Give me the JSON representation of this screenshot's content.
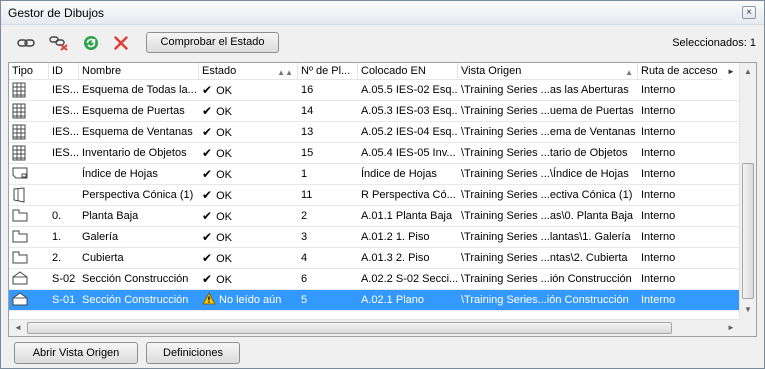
{
  "window": {
    "title": "Gestor de Dibujos",
    "close_glyph": "×"
  },
  "toolbar": {
    "icons": [
      "link-icon",
      "unlink-icon",
      "refresh-icon",
      "delete-icon"
    ],
    "check_status_label": "Comprobar el Estado",
    "selected_label": "Seleccionados: 1"
  },
  "table": {
    "columns": [
      {
        "label": "Tipo"
      },
      {
        "label": "ID"
      },
      {
        "label": "Nombre"
      },
      {
        "label": "Estado",
        "sort": "▲▲"
      },
      {
        "label": "Nº de Pl..."
      },
      {
        "label": "Colocado EN"
      },
      {
        "label": "Vista Origen",
        "sort": "▲"
      },
      {
        "label": "Ruta de acceso"
      }
    ],
    "header_more": "►",
    "rows": [
      {
        "type_icon": "schedule-icon",
        "id": "IES...",
        "name": "Esquema de Todas la...",
        "status": "OK",
        "status_kind": "ok",
        "sheets": "16",
        "placed_in": "A.05.5 IES-02 Esq...",
        "source_view": "\\Training Series ...as las Aberturas",
        "path": "Interno"
      },
      {
        "type_icon": "schedule-icon",
        "id": "IES...",
        "name": "Esquema de Puertas",
        "status": "OK",
        "status_kind": "ok",
        "sheets": "14",
        "placed_in": "A.05.3 IES-03 Esq...",
        "source_view": "\\Training Series ...uema de Puertas",
        "path": "Interno"
      },
      {
        "type_icon": "schedule-icon",
        "id": "IES...",
        "name": "Esquema de Ventanas",
        "status": "OK",
        "status_kind": "ok",
        "sheets": "13",
        "placed_in": "A.05.2 IES-04 Esq...",
        "source_view": "\\Training Series ...ema de Ventanas",
        "path": "Interno"
      },
      {
        "type_icon": "schedule-icon",
        "id": "IES...",
        "name": "Inventario de Objetos",
        "status": "OK",
        "status_kind": "ok",
        "sheets": "15",
        "placed_in": "A.05.4 IES-05 Inv...",
        "source_view": "\\Training Series ...tario de Objetos",
        "path": "Interno"
      },
      {
        "type_icon": "sheet-index-icon",
        "id": "",
        "name": "Índice de Hojas",
        "status": "OK",
        "status_kind": "ok",
        "sheets": "1",
        "placed_in": "Índice de Hojas",
        "source_view": "\\Training Series ...\\Índice de Hojas",
        "path": "Interno"
      },
      {
        "type_icon": "perspective-icon",
        "id": "",
        "name": "Perspectiva Cónica (1)",
        "status": "OK",
        "status_kind": "ok",
        "sheets": "11",
        "placed_in": "R Perspectiva Có...",
        "source_view": "\\Training Series ...ectiva Cónica (1)",
        "path": "Interno"
      },
      {
        "type_icon": "floor-plan-icon",
        "id": "0.",
        "name": "Planta Baja",
        "status": "OK",
        "status_kind": "ok",
        "sheets": "2",
        "placed_in": "A.01.1 Planta Baja",
        "source_view": "\\Training Series ...as\\0. Planta Baja",
        "path": "Interno"
      },
      {
        "type_icon": "floor-plan-icon",
        "id": "1.",
        "name": "Galería",
        "status": "OK",
        "status_kind": "ok",
        "sheets": "3",
        "placed_in": "A.01.2 1. Piso",
        "source_view": "\\Training Series ...lantas\\1. Galería",
        "path": "Interno"
      },
      {
        "type_icon": "floor-plan-icon",
        "id": "2.",
        "name": "Cubierta",
        "status": "OK",
        "status_kind": "ok",
        "sheets": "4",
        "placed_in": "A.01.3 2. Piso",
        "source_view": "\\Training Series ...ntas\\2. Cubierta",
        "path": "Interno"
      },
      {
        "type_icon": "section-icon",
        "id": "S-02",
        "name": "Sección Construcción",
        "status": "OK",
        "status_kind": "ok",
        "sheets": "6",
        "placed_in": "A.02.2 S-02 Secci...",
        "source_view": "\\Training Series ...ión Construcción",
        "path": "Interno"
      },
      {
        "type_icon": "section-icon",
        "id": "S-01",
        "name": "Sección Construcción",
        "status": "No leído aún",
        "status_kind": "warning",
        "sheets": "5",
        "placed_in": "A.02.1 Plano",
        "source_view": "\\Training Series...ión Construcción",
        "path": "Interno",
        "selected": true
      }
    ]
  },
  "footer": {
    "open_source_label": "Abrir Vista Origen",
    "definitions_label": "Definiciones"
  },
  "colors": {
    "selection": "#3399ff",
    "refresh_green": "#2aa34a",
    "delete_red": "#e33b2e",
    "warning_yellow": "#f5c400"
  }
}
